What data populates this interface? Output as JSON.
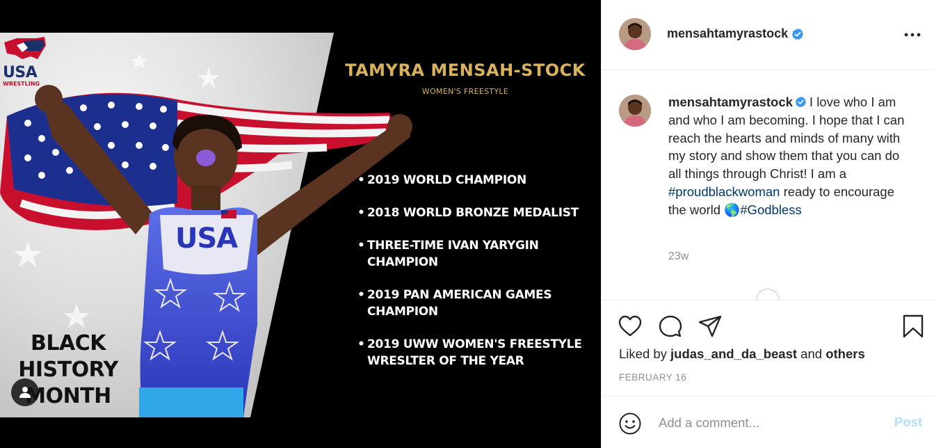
{
  "post": {
    "logo": {
      "title": "USA",
      "subtitle": "WRESTLING"
    },
    "poster_name": "TAMYRA MENSAH-STOCK",
    "poster_subtitle": "WOMEN'S FREESTYLE",
    "achievements": [
      "2019 WORLD CHAMPION",
      "2018 WORLD BRONZE MEDALIST",
      "THREE-TIME IVAN YARYGIN CHAMPION",
      "2019 PAN AMERICAN GAMES CHAMPION",
      "2019 UWW WOMEN'S FREESTYLE WRESLTER OF THE YEAR"
    ],
    "banner": [
      "BLACK",
      "HISTORY",
      "MONTH"
    ],
    "singlet_text": "USA",
    "tag_icon": "user-tag-icon"
  },
  "header": {
    "username": "mensahtamyrastock",
    "verified_icon": "verified-badge-icon",
    "more_icon": "more-options-icon"
  },
  "caption": {
    "username": "mensahtamyrastock",
    "text_part1": "I love who I am and who I am becoming. I hope that I can reach the hearts and minds of many with my story and show them that you can do all things through Christ! I am a ",
    "hashtag1": "#proudblackwoman",
    "text_part2": " ready to encourage the world ",
    "emoji": "🌎",
    "hashtag2": "#Godbless",
    "timestamp": "23w"
  },
  "actions": {
    "icons": [
      "heart-icon",
      "comment-icon",
      "share-icon",
      "bookmark-icon"
    ],
    "liked_prefix": "Liked by ",
    "liked_user": "judas_and_da_beast",
    "liked_mid": " and ",
    "liked_others": "others",
    "date": "FEBRUARY 16"
  },
  "comment_bar": {
    "placeholder": "Add a comment...",
    "post_label": "Post",
    "emoji_icon": "emoji-smile-icon"
  },
  "colors": {
    "link": "#00376b",
    "post_disabled": "#b2dffc",
    "verified": "#3897f0",
    "poster_gold": "#d9b25c"
  }
}
